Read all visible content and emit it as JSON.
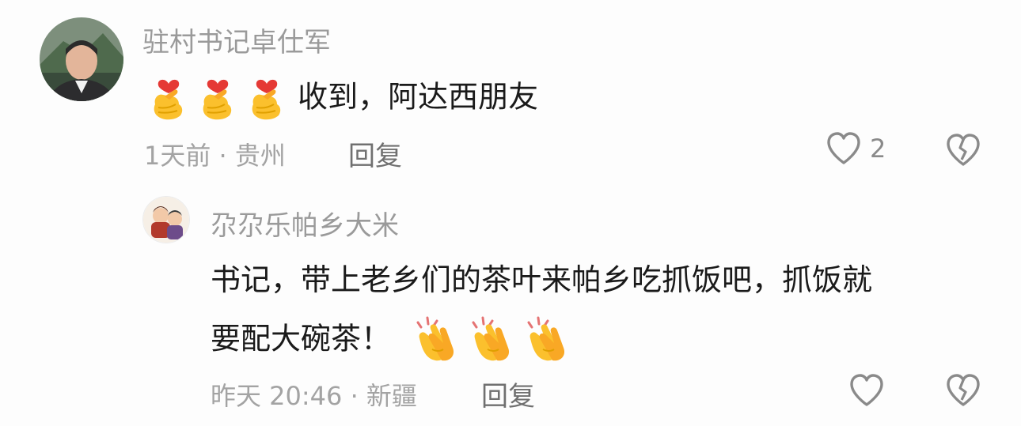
{
  "comments": [
    {
      "username": "驻村书记卓仕军",
      "text": "收到，阿达西朋友",
      "meta": "1天前 · 贵州",
      "reply_label": "回复",
      "like_count": "2",
      "emoji": [
        "finger-heart",
        "finger-heart",
        "finger-heart"
      ]
    },
    {
      "username": "尕尕乐帕乡大米",
      "text_line1": "书记，带上老乡们的茶叶来帕乡吃抓饭吧，抓饭就",
      "text_line2": "要配大碗茶！",
      "meta": "昨天 20:46 · 新疆",
      "reply_label": "回复",
      "like_count": "",
      "emoji": [
        "clapping-hands",
        "clapping-hands",
        "clapping-hands"
      ]
    }
  ],
  "colors": {
    "username": "#9a9a9a",
    "meta": "#a3a3a3",
    "reply": "#707070",
    "text": "#1a1a1a",
    "emoji_yellow": "#FBC02D",
    "heart_red": "#E53935"
  }
}
